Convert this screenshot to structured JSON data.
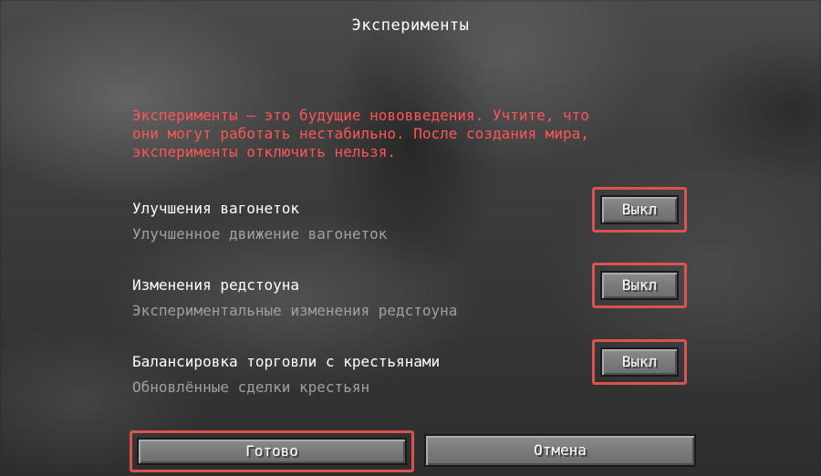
{
  "screen": {
    "title": "Эксперименты"
  },
  "warning": {
    "lines": [
      "Эксперименты — это будущие нововведения. Учтите, что",
      "они могут работать нестабильно. После создания мира,",
      "эксперименты отключить нельзя."
    ],
    "color": "#ff5555"
  },
  "experiments": [
    {
      "name": "Улучшения вагонеток",
      "description": "Улучшенное движение вагонеток",
      "toggle_label": "Выкл"
    },
    {
      "name": "Изменения редстоуна",
      "description": "Экспериментальные изменения редстоуна",
      "toggle_label": "Выкл"
    },
    {
      "name": "Балансировка торговли с крестьянами",
      "description": "Обновлённые сделки крестьян",
      "toggle_label": "Выкл"
    }
  ],
  "footer": {
    "done_label": "Готово",
    "cancel_label": "Отмена"
  },
  "colors": {
    "highlight": "#d9534f",
    "description": "#a0a0a0"
  }
}
